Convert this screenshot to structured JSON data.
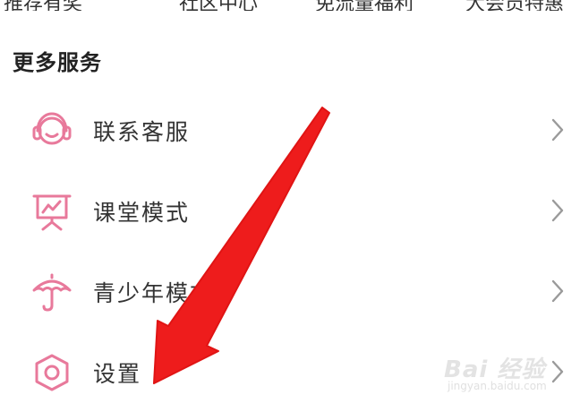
{
  "top_row": {
    "items": [
      "推荐有奖",
      "社区中心",
      "免流量福利",
      "大会员特惠"
    ]
  },
  "section": {
    "title": "更多服务"
  },
  "menu": {
    "items": [
      {
        "label": "联系客服",
        "icon": "headset-icon"
      },
      {
        "label": "课堂模式",
        "icon": "presentation-board-icon"
      },
      {
        "label": "青少年模式",
        "icon": "umbrella-icon"
      },
      {
        "label": "设置",
        "icon": "hexagon-gear-icon"
      }
    ]
  },
  "colors": {
    "icon_pink": "#e8799b",
    "arrow_red": "#ee1c1c",
    "chevron": "#9a9a9a"
  },
  "watermark": {
    "logo": "Bai 经验",
    "url": "jingyan.baidu.com"
  }
}
